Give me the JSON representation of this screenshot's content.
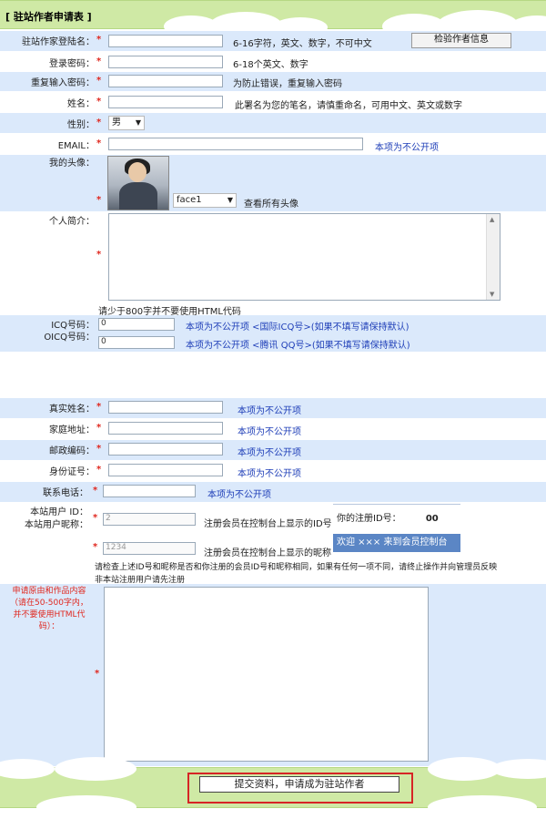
{
  "form_title": "[ 驻站作者申请表 ]",
  "fields": {
    "login_name": {
      "label": "驻站作家登陆名：",
      "hint": "6-16字符，英文、数字，不可中文",
      "check_button": "检验作者信息"
    },
    "password": {
      "label": "登录密码：",
      "hint": "6-18个英文、数字"
    },
    "password_repeat": {
      "label": "重复输入密码：",
      "hint": "为防止错误，重复输入密码"
    },
    "pen_name": {
      "label": "姓名：",
      "hint": "此署名为您的笔名，请慎重命名，可用中文、英文或数字"
    },
    "gender": {
      "label": "性别：",
      "value": "男"
    },
    "email": {
      "label": "EMAIL：",
      "hint": "本项为不公开项"
    },
    "avatar": {
      "label": "我的头像：",
      "select_value": "face1",
      "view_all": "查看所有头像"
    },
    "intro": {
      "label": "个人简介：",
      "note": "请少于800字并不要使用HTML代码"
    },
    "icq": {
      "label": "ICQ号码：",
      "value": "0",
      "hint": "本项为不公开项  <国际ICQ号>(如果不填写请保持默认)"
    },
    "oicq": {
      "label": "OICQ号码：",
      "value": "0",
      "hint": "本项为不公开项  <腾讯  QQ号>(如果不填写请保持默认)"
    },
    "real_name": {
      "label": "真实姓名：",
      "hint": "本项为不公开项"
    },
    "address": {
      "label": "家庭地址：",
      "hint": "本项为不公开项"
    },
    "zip": {
      "label": "邮政编码：",
      "hint": "本项为不公开项"
    },
    "id_card": {
      "label": "身份证号：",
      "hint": "本项为不公开项"
    },
    "phone": {
      "label": "联系电话：",
      "hint": "本项为不公开项"
    },
    "site_user_id": {
      "label": "本站用户 ID：",
      "label2": "本站用户昵称：",
      "value": "2",
      "hint": "注册会员在控制台上显示的ID号"
    },
    "site_user_nick": {
      "value": "1234",
      "hint": "注册会员在控制台上显示的昵称"
    },
    "check_note_1": "请检查上述ID号和昵称是否和你注册的会员ID号和昵称相同，如果有任何一项不同，请终止操作并向管理员反映",
    "check_note_2": "非本站注册用户请先注册",
    "reason": {
      "label_lines": [
        "申请原由和作品内容",
        "（请在50-500字内，",
        "并不要使用HTML代",
        "码）："
      ]
    }
  },
  "member_panel": {
    "id_label": "你的注册ID号：",
    "id_value": "00",
    "welcome": "欢迎  ×××  来到会员控制台"
  },
  "required_mark": "*",
  "submit_label": "提交资料，申请成为驻站作者",
  "colors": {
    "band_green": "#cfe9a5",
    "row_blue": "#dbe9fb",
    "required_red": "#e0271e",
    "hint_blue": "#1f3fb8",
    "highlight_red": "#d62525"
  }
}
